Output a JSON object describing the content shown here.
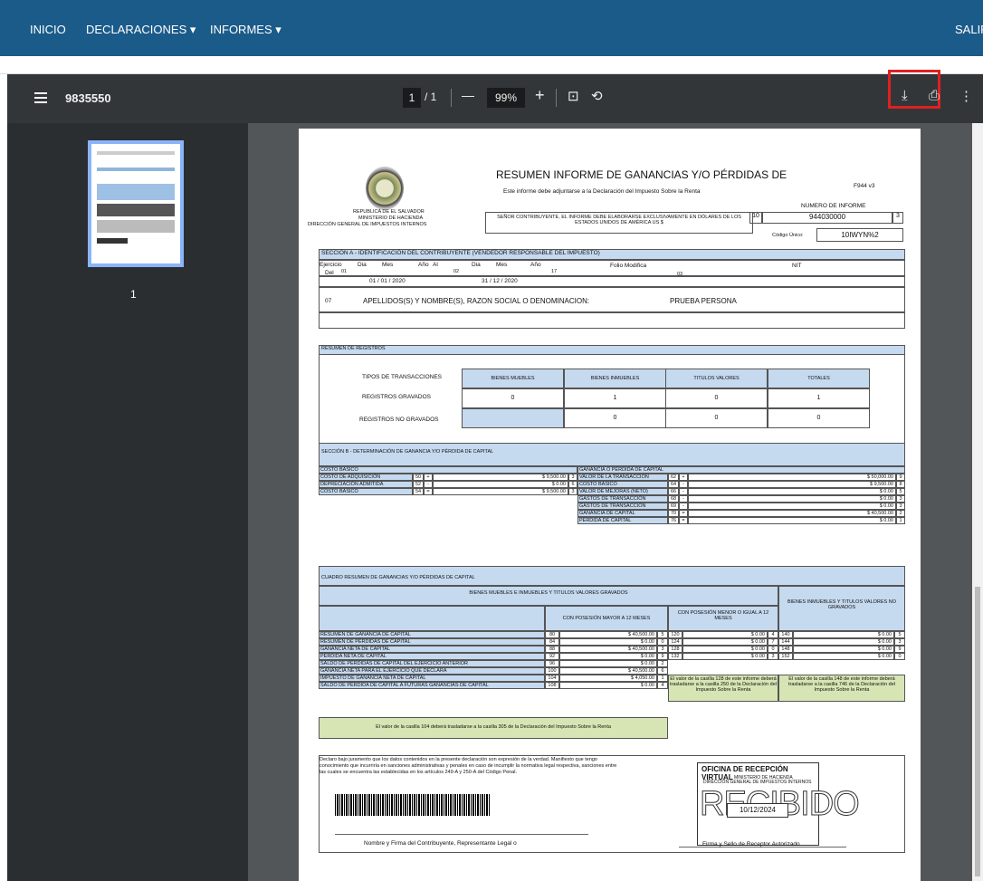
{
  "nav": {
    "inicio": "INICIO",
    "declaraciones": "DECLARACIONES ▾",
    "informes": "INFORMES ▾",
    "salir": "SALIR"
  },
  "viewer": {
    "doc_id": "9835550",
    "page_current": "1",
    "page_total": "/ 1",
    "zoom": "99%",
    "zoom_out": "—",
    "zoom_in": "+",
    "thumb_label": "1"
  },
  "header": {
    "title": "RESUMEN INFORME DE GANANCIAS Y/O PÉRDIDAS DE",
    "subtitle": "Este informe debe adjuntarse a la Declaración del Impuesto Sobre la Renta",
    "form_code": "F944 v3",
    "org1": "REPUBLICA DE EL SALVADOR",
    "org2": "MINISTERIO DE HACIENDA",
    "org3": "DIRECCIÓN GENERAL DE IMPUESTOS INTERNOS",
    "notice": "SEÑOR CONTRIBUYENTE, EL INFORME DEBE ELABORARSE EXCLUSIVAMENTE EN DÓLARES DE LOS ESTADOS UNIDOS DE AMÉRICA US $",
    "numero_label": "NUMERO DE INFORME",
    "numero_pre": "10",
    "numero": "944030000",
    "numero_post": "3",
    "codigo_label": "Código Único:",
    "codigo": "10IWYN%2"
  },
  "seccion_a": {
    "title": "SECCIÓN A - IDENTIFICACIÓN DEL CONTRIBUYENTE (VENDEDOR RESPONSABLE DEL IMPUESTO)",
    "ejercicio": "Ejercicio",
    "del": "Del",
    "c01": "01",
    "dia": "Dia",
    "mes": "Mes",
    "anio": "Año",
    "al": "Al",
    "c02": "02",
    "desde": "01 / 01 / 2020",
    "hasta": "31 / 12 / 2020",
    "c17": "17",
    "folio": "Folio Modifica",
    "c03": "03",
    "nit": "NIT",
    "c07": "07",
    "nombre_label": "APELLIDOS(S) Y NOMBRE(S), RAZON SOCIAL O DENOMINACION:",
    "nombre": "PRUEBA PERSONA"
  },
  "resumen": {
    "title": "RESUMEN DE REGISTROS",
    "tipos": "TIPOS DE TRANSACCIONES",
    "gravados": "REGISTROS GRAVADOS",
    "no_gravados": "REGISTROS NO GRAVADOS",
    "headers": [
      "BIENES MUEBLES",
      "BIENES INMUEBLES",
      "TITULOS VALORES",
      "TOTALES"
    ],
    "grav_vals": [
      "0",
      "1",
      "0",
      "1"
    ],
    "nograv_vals": [
      "0",
      "0",
      "0"
    ]
  },
  "seccion_b": {
    "title": "SECCIÓN B - DETERMINACIÓN DE GANANCIA Y/O PÉRDIDA DE CAPITAL",
    "left_title": "COSTO BASICO",
    "right_title": "GANANCIA O PÉRDIDA DE CAPITAL",
    "left": [
      {
        "label": "COSTO DE ADQUISICIÓN",
        "code": "50",
        "op": "+",
        "val": "$ 9,500.00",
        "d": "3"
      },
      {
        "label": "DEPRECIACIÓN ADMITIDA",
        "code": "52",
        "op": "-",
        "val": "$ 0.00",
        "d": "6"
      },
      {
        "label": "COSTO BASICO",
        "code": "54",
        "op": "=",
        "val": "$ 9,500.00",
        "d": "3"
      }
    ],
    "right": [
      {
        "label": "VALOR DE LA TRANSACCIÓN",
        "code": "62",
        "op": "+",
        "val": "$ 50,000.00",
        "d": "9"
      },
      {
        "label": "COSTO BÁSICO",
        "code": "64",
        "op": "-",
        "val": "$ 9,500.00",
        "d": "8"
      },
      {
        "label": "VALOR DE MEJORAS (NETO)",
        "code": "66",
        "op": "-",
        "val": "$ 0.00",
        "d": "5"
      },
      {
        "label": "GASTOS DE TRANSACCIÓN",
        "code": "68",
        "op": "-",
        "val": "$ 0.00",
        "d": "3"
      },
      {
        "label": "GASTOS DE TRANSACCIÓN",
        "code": "69",
        "op": "-",
        "val": "$ 0.00",
        "d": "3"
      },
      {
        "label": "GANANCIA DE CAPITAL",
        "code": "70",
        "op": "=",
        "val": "$ 40,500.00",
        "d": "2"
      },
      {
        "label": "PÉRDIDA DE CAPITAL",
        "code": "76",
        "op": "=",
        "val": "$ 0.00",
        "d": "1"
      }
    ]
  },
  "cuadro": {
    "title": "CUADRO RESUMEN DE GANANCIAS Y/O PÉRDIDAS DE CAPITAL",
    "grav_title": "BIENES MUEBLES E INMUEBLES Y TITULOS VALORES GRAVADOS",
    "nograv_title": "BIENES INMUEBLES Y TITULOS VALORES NO GRAVADOS",
    "mayor": "CON POSESIÓN MAYOR A 12 MESES",
    "menor": "CON POSESIÓN MENOR O IGUAL A 12 MESES",
    "rows": [
      {
        "label": "RESUMEN DE GANANCIA DE CAPITAL",
        "c1": "80",
        "v1": "$ 40,500.00",
        "d1": "5",
        "c2": "120",
        "v2": "$ 0.00",
        "d2": "4",
        "c3": "140",
        "v3": "$ 0.00",
        "d3": "5"
      },
      {
        "label": "RESUMEN DE PÉRDIDAS DE CAPITAL",
        "c1": "84",
        "v1": "$ 0.00",
        "d1": "0",
        "c2": "124",
        "v2": "$ 0.00",
        "d2": "7",
        "c3": "144",
        "v3": "$ 0.00",
        "d3": "3"
      },
      {
        "label": "GANANCIA NETA DE CAPITAL",
        "c1": "88",
        "v1": "$ 40,500.00",
        "d1": "3",
        "c2": "128",
        "v2": "$ 0.00",
        "d2": "0",
        "c3": "148",
        "v3": "$ 0.00",
        "d3": "9"
      },
      {
        "label": "PÉRDIDA NETA DE CAPITAL",
        "c1": "92",
        "v1": "$ 0.00",
        "d1": "9",
        "c2": "132",
        "v2": "$ 0.00",
        "d2": "3",
        "c3": "152",
        "v3": "$ 0.00",
        "d3": "0"
      },
      {
        "label": "SALDO DE PÉRDIDAS DE CAPITAL DEL EJERCICIO ANTERIOR",
        "c1": "96",
        "v1": "$ 0.00",
        "d1": "2"
      },
      {
        "label": "GANANCIA NETA PARA EL EJERCICIO QUE DECLARA",
        "c1": "100",
        "v1": "$ 40,500.00",
        "d1": "6"
      },
      {
        "label": "IMPUESTO DE GANANCIA NETA DE CAPITAL",
        "c1": "104",
        "v1": "$ 4,050.00",
        "d1": "1"
      },
      {
        "label": "SALDO DE PÉRDIDA DE CAPITAL A FUTURAS GANANCIAS DE CAPITAL",
        "c1": "108",
        "v1": "$ 0.00",
        "d1": "4"
      }
    ],
    "note_128": "El valor de la casilla 128 de este informe deberá trasladarse a la casilla 250 de la Declaración del Impuesto Sobre la Renta",
    "note_148": "El valor de la casilla 148 de este informe deberá trasladarse a la casilla 746 de la Declaración del Impuesto Sobre la Renta",
    "note_104": "El valor de la casilla 104 deberá trasladarse a la casilla 305 de la Declaración del Impuesto Sobre la Renta"
  },
  "footer": {
    "juramento": "Declaro bajo juramento que los datos contenidos en la presente declaración son expresión de la verdad. Manifiesto que tengo conocimiento que incurriría en sanciones administrativas y penales en caso de incumplir la normativa legal respectiva, sanciones entre las cuales se encuentra las establecidas en los artículos 249-A y 250-A del Código Penal.",
    "firma_contrib": "Nombre y Firma del Contribuyente, Representante Legal o",
    "oficina": "OFICINA DE RECEPCIÓN VIRTUAL",
    "oficina2": "MINISTERIO DE HACIENDA",
    "oficina3": "DIRECCIÓN GENERAL DE IMPUESTOS INTERNOS",
    "recibido": "RECIBIDO",
    "fecha": "10/12/2024",
    "firma_receptor": "Firma y Sello de Receptor Autorizado"
  },
  "colors": {
    "nav": "#1b5b8a",
    "section": "#c5d9ef",
    "note": "#d7e5b4",
    "highlight": "#e02020"
  }
}
